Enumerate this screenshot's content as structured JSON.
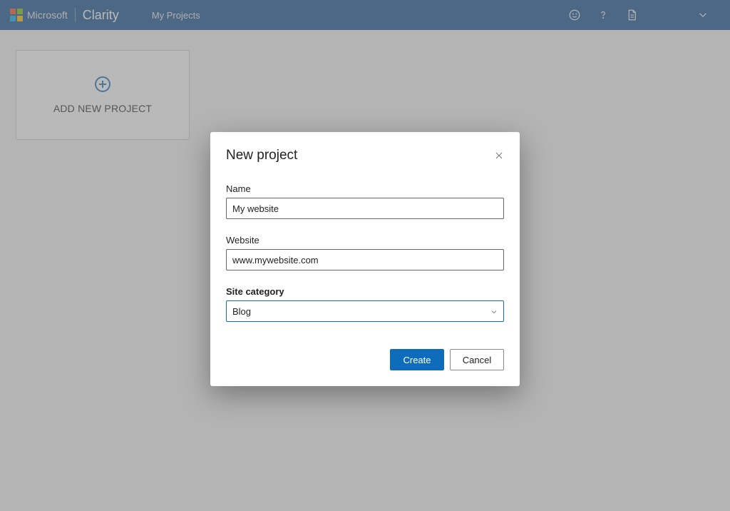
{
  "header": {
    "brand_ms": "Microsoft",
    "brand_product": "Clarity",
    "nav_my_projects": "My Projects",
    "logo_colors": {
      "tl": "#f25022",
      "tr": "#7fba00",
      "bl": "#00a4ef",
      "br": "#ffb900"
    }
  },
  "main": {
    "add_project_label": "ADD NEW PROJECT"
  },
  "dialog": {
    "title": "New project",
    "fields": {
      "name": {
        "label": "Name",
        "value": "My website"
      },
      "website": {
        "label": "Website",
        "value": "www.mywebsite.com"
      },
      "site_category": {
        "label": "Site category",
        "value": "Blog"
      }
    },
    "actions": {
      "create": "Create",
      "cancel": "Cancel"
    }
  }
}
